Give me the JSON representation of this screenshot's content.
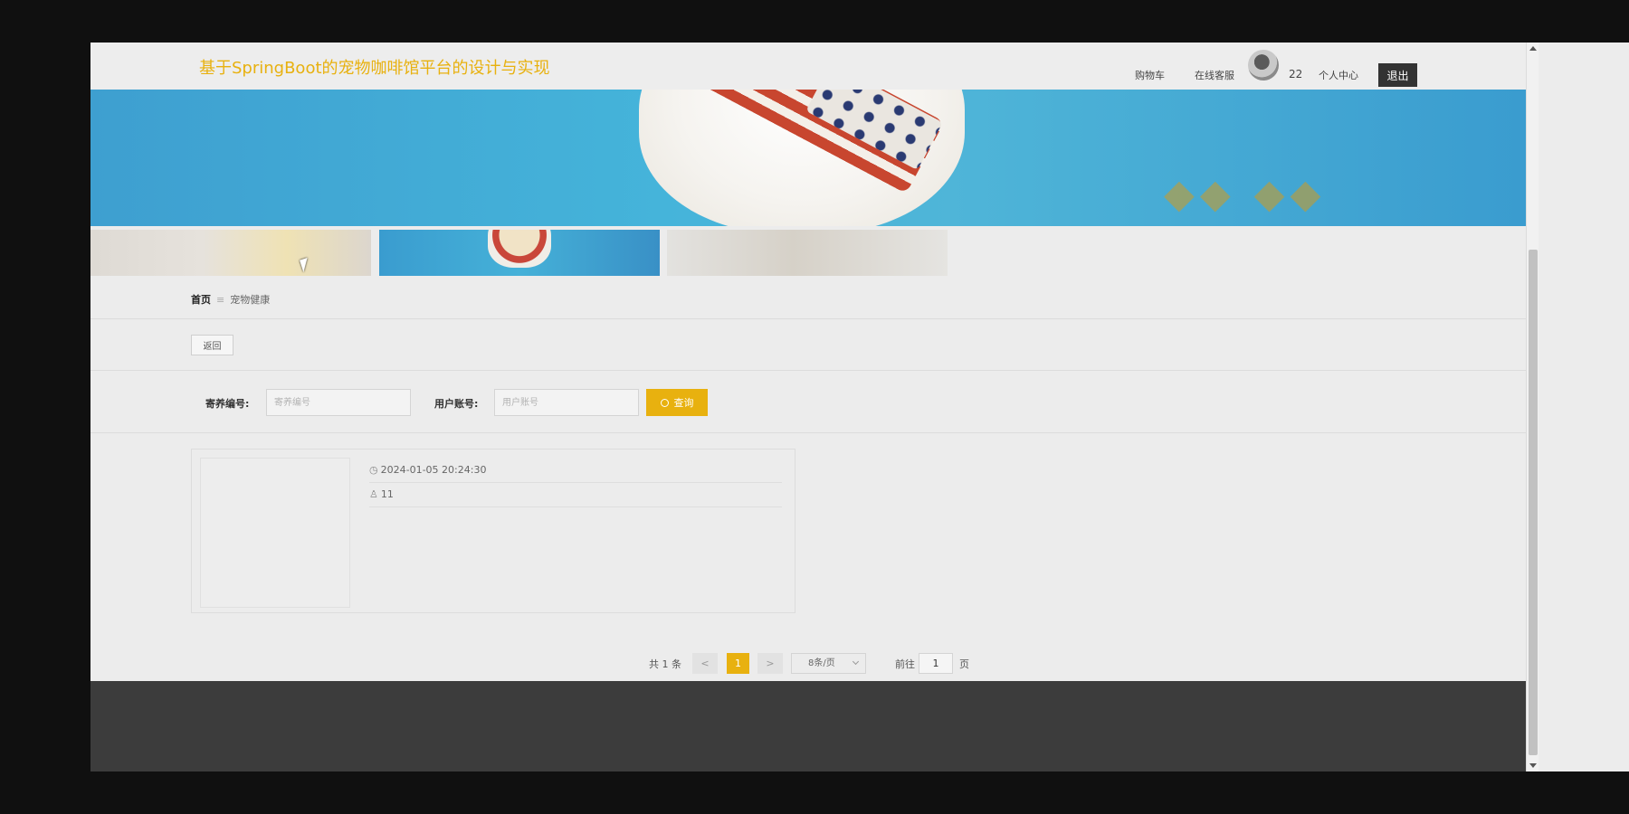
{
  "header": {
    "site_title": "基于SpringBoot的宠物咖啡馆平台的设计与实现",
    "nav": {
      "cart": "购物车",
      "support": "在线客服",
      "username": "22",
      "profile": "个人中心",
      "logout": "退出"
    }
  },
  "breadcrumb": {
    "home": "首页",
    "separator": "≡",
    "current": "宠物健康"
  },
  "toolbar": {
    "back_label": "返回"
  },
  "search": {
    "field1_label": "寄养编号:",
    "field1_placeholder": "寄养编号",
    "field2_label": "用户账号:",
    "field2_placeholder": "用户账号",
    "button_label": "查询"
  },
  "records": [
    {
      "time": "2024-01-05 20:24:30",
      "user": "11"
    }
  ],
  "pagination": {
    "total": "共 1 条",
    "prev": "<",
    "current_page": "1",
    "next": ">",
    "page_size": "8条/页",
    "goto_prefix": "前往",
    "goto_value": "1",
    "goto_suffix": "页"
  },
  "colors": {
    "accent": "#e8b10f",
    "footer": "#3c3c3c",
    "background": "#ececec"
  }
}
